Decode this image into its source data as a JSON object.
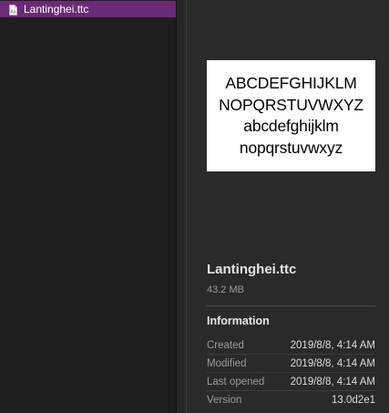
{
  "file_list": {
    "items": [
      {
        "name": "Lantinghei.ttc",
        "icon": "file-icon",
        "selected": true
      }
    ],
    "selection_color": "#6b2a78"
  },
  "preview": {
    "sample_lines": [
      "ABCDEFGHIJKLM",
      "NOPQRSTUVWXYZ",
      "abcdefghijklm",
      "nopqrstuvwxyz"
    ]
  },
  "info": {
    "title": "Lantinghei.ttc",
    "size": "43.2 MB",
    "heading": "Information",
    "rows": [
      {
        "label": "Created",
        "value": "2019/8/8, 4:14 AM"
      },
      {
        "label": "Modified",
        "value": "2019/8/8, 4:14 AM"
      },
      {
        "label": "Last opened",
        "value": "2019/8/8, 4:14 AM"
      },
      {
        "label": "Version",
        "value": "13.0d2e1"
      }
    ]
  }
}
